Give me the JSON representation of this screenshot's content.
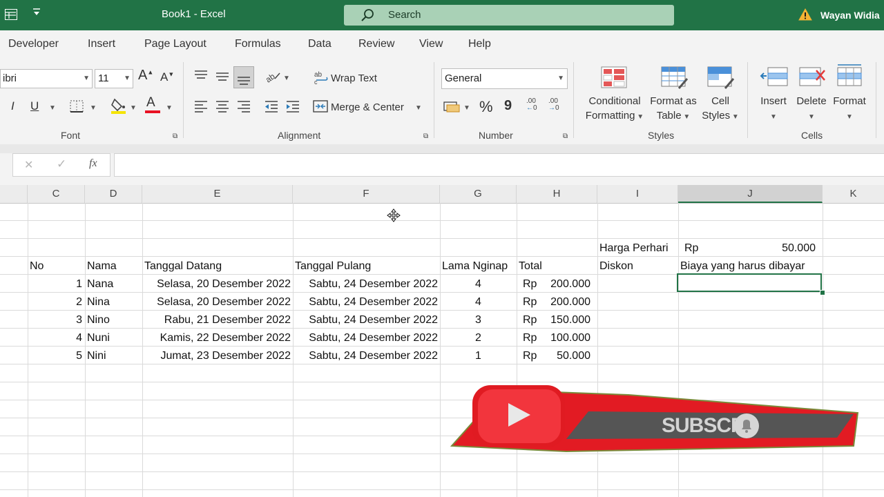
{
  "titlebar": {
    "doc_title": "Book1  -  Excel",
    "search_placeholder": "Search",
    "user_name": "Wayan Widia",
    "warning_icon": "warning-icon",
    "accent_color": "#217346"
  },
  "menu": [
    "Developer",
    "Insert",
    "Page Layout",
    "Formulas",
    "Data",
    "Review",
    "View",
    "Help"
  ],
  "ribbon": {
    "font": {
      "label": "Font",
      "font_name": "ibri",
      "font_size": "11",
      "grow_glyph": "A",
      "shrink_glyph": "A",
      "italic": "I",
      "underline": "U",
      "font_color_glyph": "A"
    },
    "alignment": {
      "label": "Alignment",
      "wrap_text": "Wrap Text",
      "merge_center": "Merge & Center"
    },
    "number": {
      "label": "Number",
      "format": "General",
      "percent": "%",
      "comma": "9",
      "inc_decimal": ".00",
      "dec_decimal": ".00"
    },
    "styles": {
      "label": "Styles",
      "conditional_1": "Conditional",
      "conditional_2": "Formatting",
      "format_as_1": "Format as",
      "format_as_2": "Table",
      "cell_styles_1": "Cell",
      "cell_styles_2": "Styles"
    },
    "cells": {
      "label": "Cells",
      "insert": "Insert",
      "delete": "Delete",
      "format": "Format"
    }
  },
  "formula_bar": {
    "cancel": "✕",
    "enter": "✓",
    "fx": "fx",
    "value": ""
  },
  "columns": [
    "C",
    "D",
    "E",
    "F",
    "G",
    "H",
    "I",
    "J",
    "K"
  ],
  "sheet": {
    "harga_label": "Harga Perhari",
    "harga_currency": "Rp",
    "harga_value": "50.000",
    "headers": {
      "no": "No",
      "nama": "Nama",
      "tanggal_datang": "Tanggal Datang",
      "tanggal_pulang": "Tanggal Pulang",
      "lama_nginap": "Lama Nginap",
      "total": "Total",
      "diskon": "Diskon",
      "biaya": "Biaya yang harus dibayar"
    },
    "rows": [
      {
        "no": "1",
        "nama": "Nana",
        "datang": "Selasa, 20 Desember 2022",
        "pulang": "Sabtu, 24 Desember 2022",
        "lama": "4",
        "cur": "Rp",
        "total": "200.000"
      },
      {
        "no": "2",
        "nama": "Nina",
        "datang": "Selasa, 20 Desember 2022",
        "pulang": "Sabtu, 24 Desember 2022",
        "lama": "4",
        "cur": "Rp",
        "total": "200.000"
      },
      {
        "no": "3",
        "nama": "Nino",
        "datang": "Rabu, 21 Desember 2022",
        "pulang": "Sabtu, 24 Desember 2022",
        "lama": "3",
        "cur": "Rp",
        "total": "150.000"
      },
      {
        "no": "4",
        "nama": "Nuni",
        "datang": "Kamis, 22 Desember 2022",
        "pulang": "Sabtu, 24 Desember 2022",
        "lama": "2",
        "cur": "Rp",
        "total": "100.000"
      },
      {
        "no": "5",
        "nama": "Nini",
        "datang": "Jumat, 23 Desember 2022",
        "pulang": "Sabtu, 24 Desember 2022",
        "lama": "1",
        "cur": "Rp",
        "total": "50.000"
      }
    ]
  },
  "overlay": {
    "subscribe_text": "SUBSCRI",
    "play_icon": "play-icon",
    "bell_icon": "bell-icon",
    "accent_red": "#e21b23"
  }
}
